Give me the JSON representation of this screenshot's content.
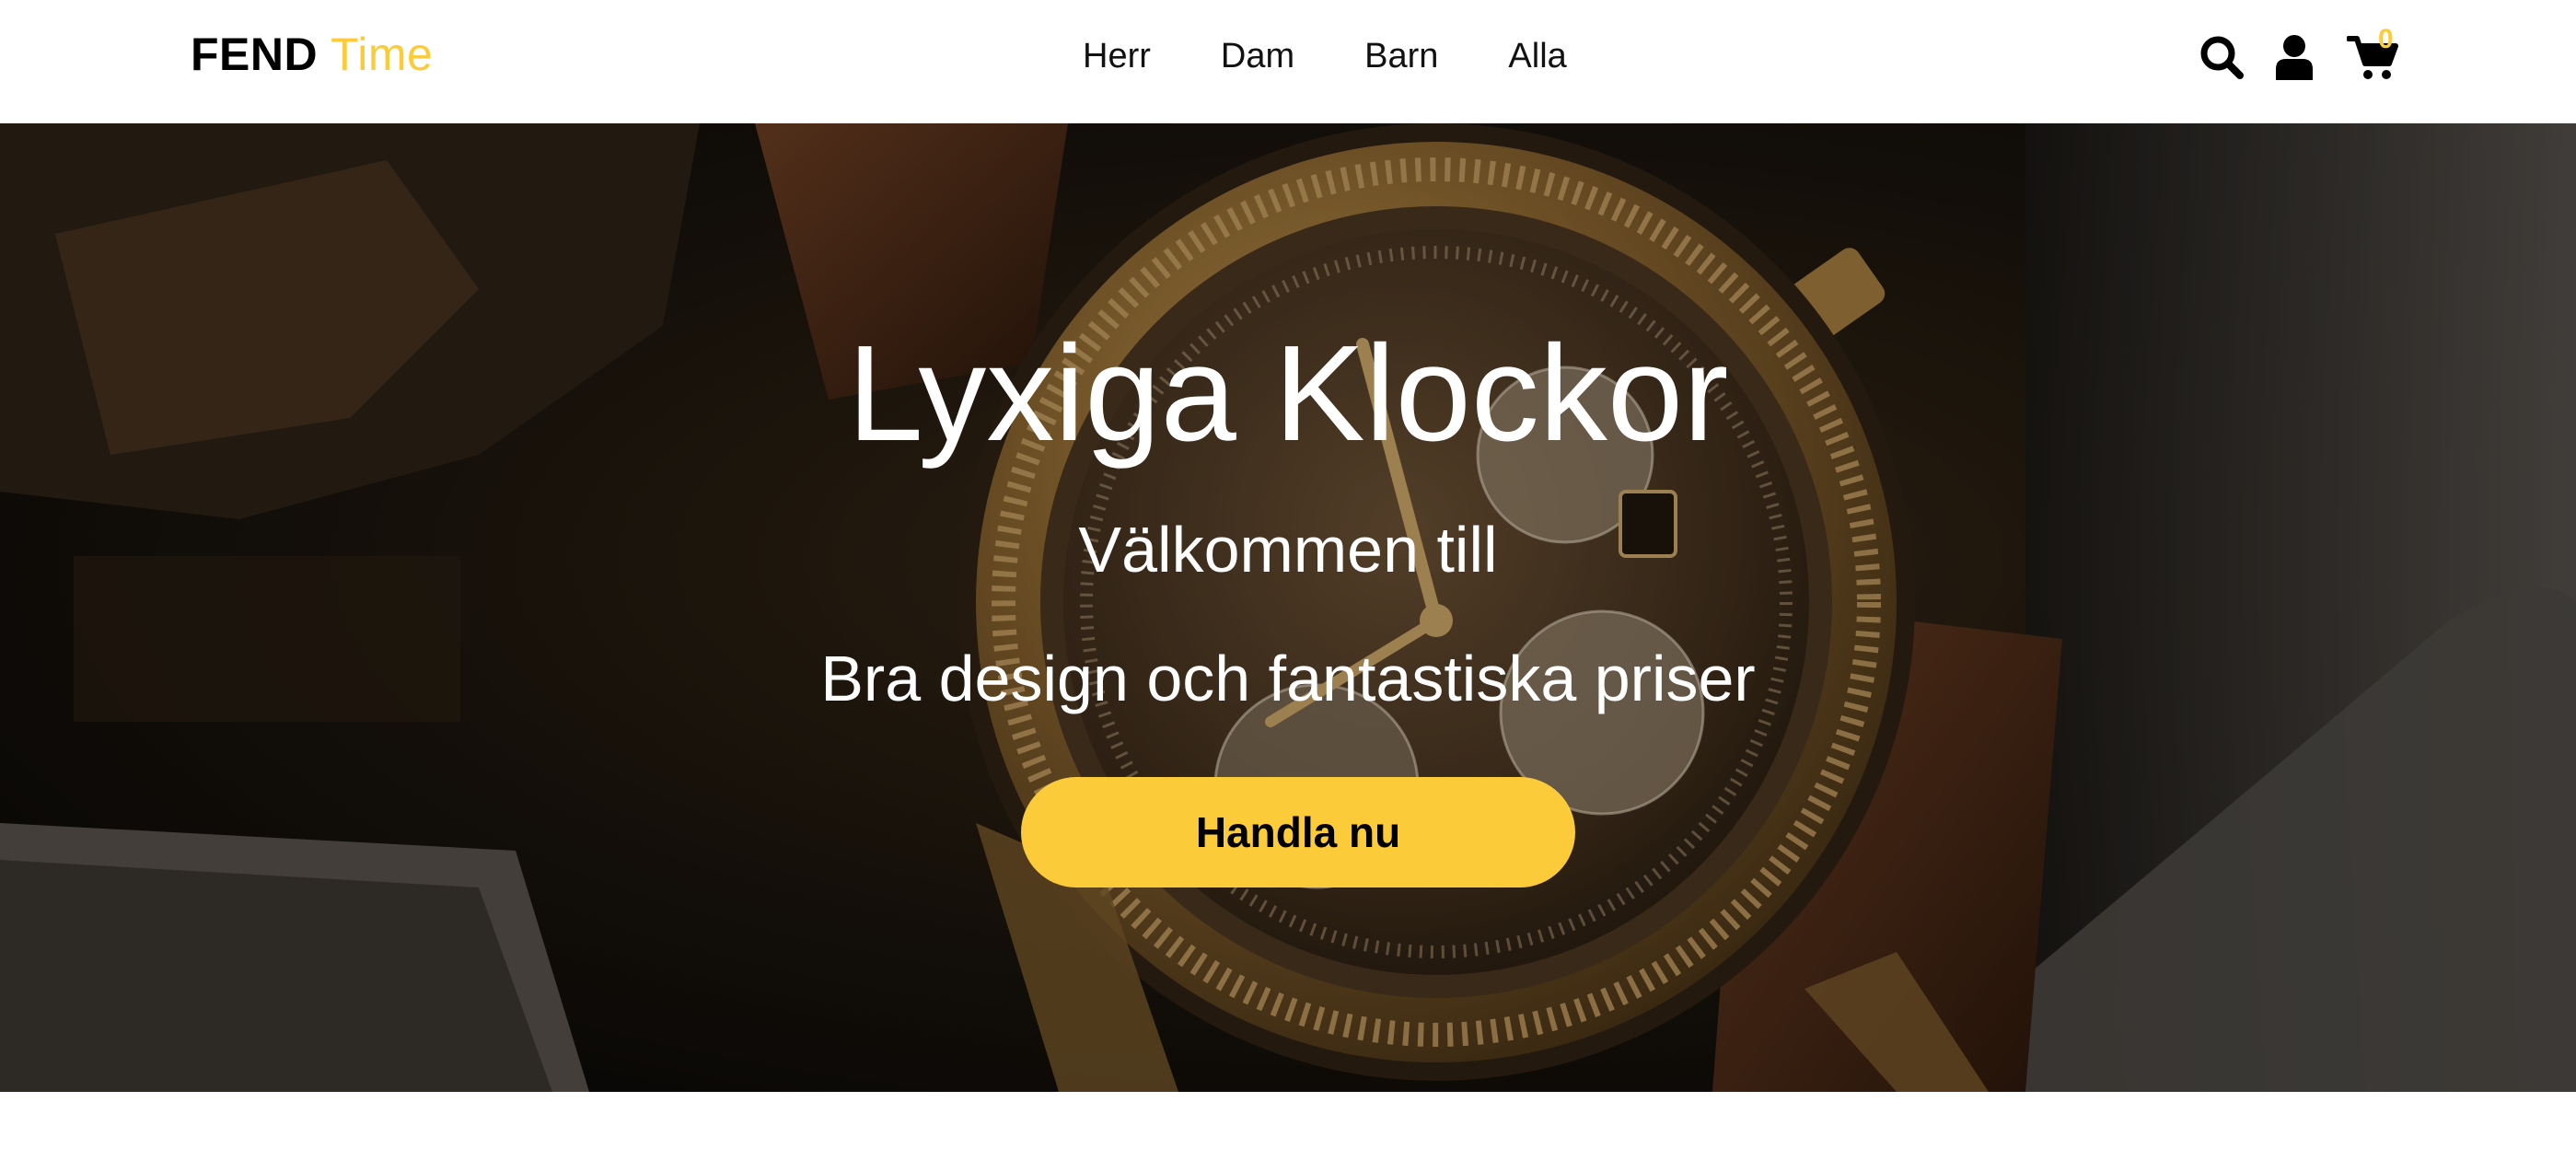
{
  "colors": {
    "accent": "#fccb39",
    "text": "#000000",
    "hero_text": "#ffffff",
    "header_bg": "#ffffff"
  },
  "header": {
    "logo": {
      "primary": "FEND",
      "secondary": "Time"
    },
    "nav": [
      {
        "label": "Herr"
      },
      {
        "label": "Dam"
      },
      {
        "label": "Barn"
      },
      {
        "label": "Alla"
      }
    ],
    "icons": {
      "search": "search-icon",
      "account": "user-icon",
      "cart": "cart-icon"
    },
    "cart_count": "0"
  },
  "hero": {
    "title": "Lyxiga Klockor",
    "subtitle": "Välkommen till",
    "tagline": "Bra design och fantastiska priser",
    "cta_label": "Handla nu",
    "background_image": "luxury-gold-watch-photo"
  }
}
